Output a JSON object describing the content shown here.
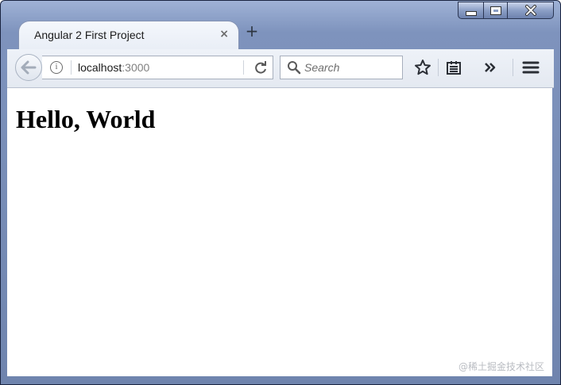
{
  "tab": {
    "title": "Angular 2 First Project",
    "close_glyph": "×"
  },
  "new_tab_glyph": "+",
  "url": {
    "host": "localhost",
    "port": ":3000"
  },
  "search": {
    "placeholder": "Search"
  },
  "page": {
    "heading": "Hello, World"
  },
  "watermark": "@稀土掘金技术社区",
  "icons": [
    "back-arrow-icon",
    "info-icon",
    "reload-icon",
    "search-icon",
    "star-icon",
    "library-icon",
    "overflow-chevron-icon",
    "hamburger-menu-icon",
    "minimize-icon",
    "maximize-icon",
    "close-icon"
  ],
  "colors": {
    "frame": "#7e93bd",
    "toolbar": "#e4e9f1",
    "content_bg": "#ffffff"
  }
}
